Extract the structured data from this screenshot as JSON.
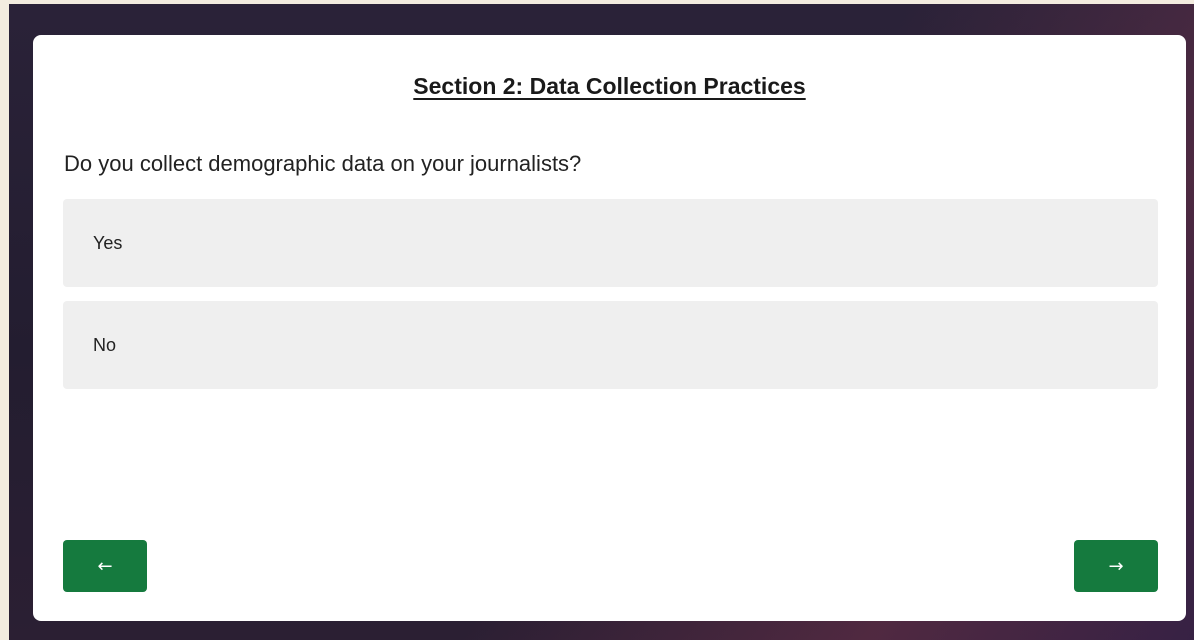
{
  "section": {
    "title": "Section 2: Data Collection Practices"
  },
  "question": {
    "text": "Do you collect demographic data on your journalists?",
    "options": [
      {
        "label": "Yes"
      },
      {
        "label": "No"
      }
    ]
  },
  "navigation": {
    "back_symbol": "←",
    "next_symbol": "→",
    "button_color": "#157a3e"
  },
  "icons": {
    "back": "arrow-left-icon",
    "next": "arrow-right-icon"
  }
}
